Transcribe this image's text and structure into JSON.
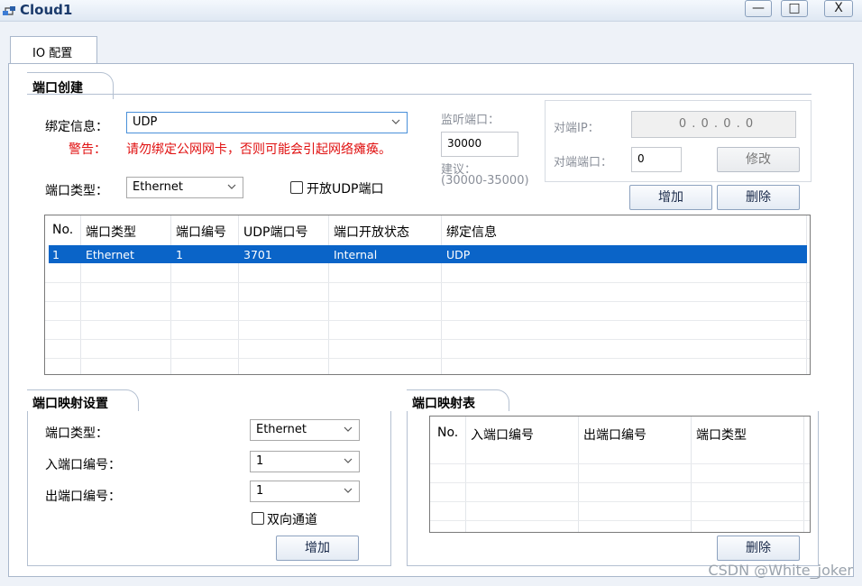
{
  "window": {
    "title": "Cloud1",
    "minimize": "—",
    "maximize": "□",
    "close": "X"
  },
  "tabs": [
    {
      "label": "IO 配置"
    }
  ],
  "port_create": {
    "header": "端口创建",
    "bind_label": "绑定信息：",
    "bind_value": "UDP",
    "warn_label": "警告：",
    "warn_text": "请勿绑定公网网卡，否则可能会引起网络瘫痪。",
    "type_label": "端口类型：",
    "type_value": "Ethernet",
    "open_udp_label": "开放UDP端口",
    "listen_label": "监听端口：",
    "listen_value": "30000",
    "suggest_label": "建议：",
    "suggest_range": "(30000-35000)",
    "peer_ip_label": "对端IP：",
    "peer_ip_value": "0 . 0 . 0 . 0",
    "peer_port_label": "对端端口：",
    "peer_port_value": "0",
    "modify_button": "修改",
    "add_button": "增加",
    "delete_button": "删除"
  },
  "port_table": {
    "columns": [
      "No.",
      "端口类型",
      "端口编号",
      "UDP端口号",
      "端口开放状态",
      "绑定信息"
    ],
    "rows": [
      [
        "1",
        "Ethernet",
        "1",
        "3701",
        "Internal",
        "UDP"
      ]
    ]
  },
  "mapping_settings": {
    "header": "端口映射设置",
    "type_label": "端口类型：",
    "type_value": "Ethernet",
    "in_label": "入端口编号：",
    "in_value": "1",
    "out_label": "出端口编号：",
    "out_value": "1",
    "bidirectional_label": "双向通道",
    "add_button": "增加"
  },
  "mapping_table": {
    "header": "端口映射表",
    "columns": [
      "No.",
      "入端口编号",
      "出端口编号",
      "端口类型"
    ],
    "delete_button": "删除"
  },
  "watermark": "CSDN @White_joker"
}
